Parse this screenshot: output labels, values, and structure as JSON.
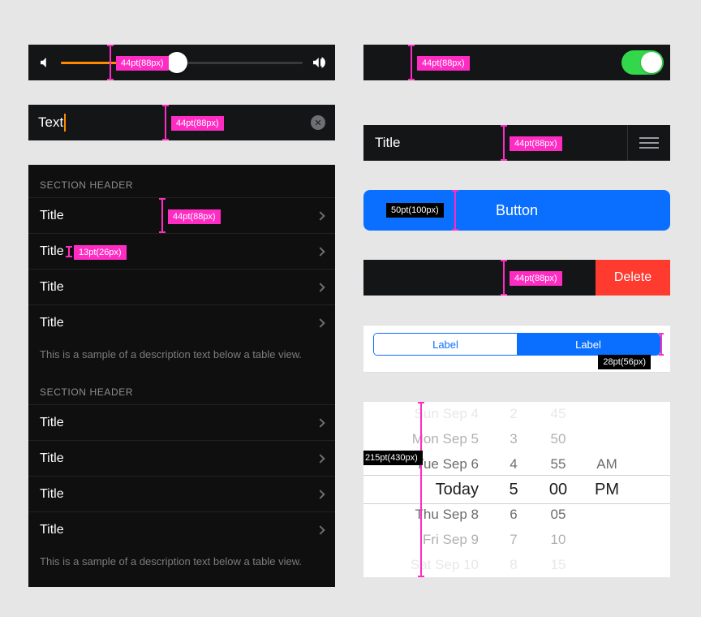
{
  "annotations": {
    "h44": "44pt(88px)",
    "h13": "13pt(26px)",
    "h50": "50pt(100px)",
    "h44b": "44pt(88px)",
    "h28": "28pt(56px)",
    "h215": "215pt(430px)"
  },
  "slider": {
    "value_pct": 48
  },
  "textField": {
    "value": "Text"
  },
  "table": {
    "section_header": "SECTION HEADER",
    "row_title": "Title",
    "footer": "This is a sample of a description text below a table view."
  },
  "titleBar": {
    "title": "Title"
  },
  "bigButton": {
    "label": "Button"
  },
  "swipe": {
    "delete": "Delete"
  },
  "segmented": {
    "a": "Label",
    "b": "Label"
  },
  "picker": {
    "dates": [
      "Sun Sep 4",
      "Mon Sep 5",
      "Tue Sep 6",
      "Today",
      "Thu Sep 8",
      "Fri Sep 9",
      "Sat Sep 10"
    ],
    "hours": [
      "2",
      "3",
      "4",
      "5",
      "6",
      "7",
      "8"
    ],
    "mins": [
      "45",
      "50",
      "55",
      "00",
      "05",
      "10",
      "15"
    ],
    "ap": {
      "top": "AM",
      "sel": "PM"
    }
  }
}
